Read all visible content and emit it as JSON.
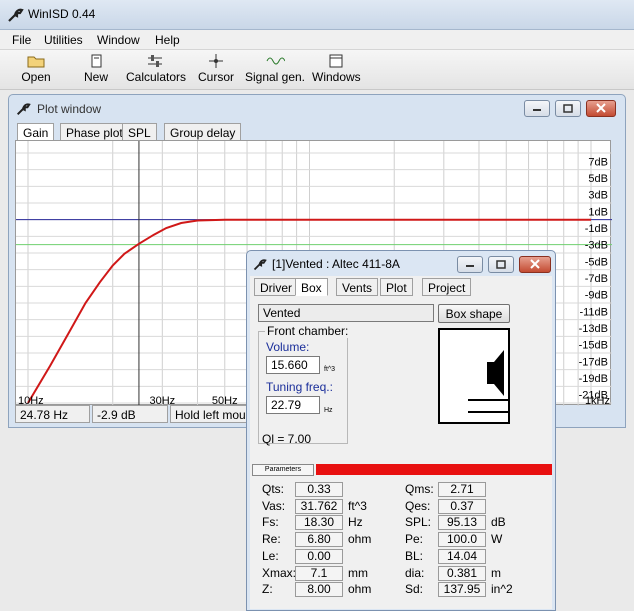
{
  "app": {
    "title": "WinISD 0.44"
  },
  "menu": [
    "File",
    "Utilities",
    "Window",
    "Help"
  ],
  "toolbar": [
    {
      "label": "Open",
      "icon": "folder-icon"
    },
    {
      "label": "New",
      "icon": "new-document-icon"
    },
    {
      "label": "Calculators",
      "icon": "calculator-sliders-icon"
    },
    {
      "label": "Cursor",
      "icon": "crosshair-icon"
    },
    {
      "label": "Signal gen.",
      "icon": "signal-wave-icon"
    },
    {
      "label": "Windows",
      "icon": "window-icon"
    }
  ],
  "plot_window": {
    "title": "Plot window",
    "tabs": [
      "Gain",
      "Phase plot",
      "SPL",
      "Group delay"
    ],
    "active_tab": "Gain",
    "y_labels": [
      "7dB",
      "5dB",
      "3dB",
      "1dB",
      "-1dB",
      "-3dB",
      "-5dB",
      "-7dB",
      "-9dB",
      "-11dB",
      "-13dB",
      "-15dB",
      "-17dB",
      "-19dB",
      "-21dB"
    ],
    "x_labels": [
      "10Hz",
      "30Hz",
      "50Hz",
      "1kHz"
    ],
    "status": {
      "freq": "24.78 Hz",
      "gain": "-2.9 dB",
      "hint": "Hold left mous"
    }
  },
  "chart_data": {
    "type": "line",
    "ylabel": "",
    "xlabel": "",
    "ylim": [
      -22,
      8
    ],
    "log_x": true,
    "cursor": {
      "x_hz": 24.78,
      "y_db": -2.9
    },
    "series": [
      {
        "color": "#d01818",
        "points": [
          [
            10,
            -22
          ],
          [
            12,
            -17.5
          ],
          [
            14,
            -13.5
          ],
          [
            16,
            -10
          ],
          [
            18,
            -7.5
          ],
          [
            20,
            -5.5
          ],
          [
            22,
            -4.1
          ],
          [
            24.78,
            -2.9
          ],
          [
            28,
            -1.8
          ],
          [
            31,
            -1
          ],
          [
            35,
            -0.4
          ],
          [
            40,
            -0.1
          ],
          [
            50,
            0
          ],
          [
            1000,
            0
          ]
        ]
      }
    ]
  },
  "box_window": {
    "title": "[1]Vented : Altec 411-8A",
    "tabs": [
      "Driver",
      "Box",
      "Vents",
      "Plot",
      "Project"
    ],
    "active_tab": "Box",
    "box_type": "Vented",
    "box_shape_button": "Box shape",
    "front_chamber_label": "Front chamber:",
    "volume_label": "Volume:",
    "volume_value": "15.660",
    "volume_unit": "ft^3",
    "tuning_label": "Tuning freq.:",
    "tuning_value": "22.79",
    "tuning_unit": "Hz",
    "ql": "Ql = 7.00",
    "params_header": "Parameters",
    "params_left": [
      {
        "label": "Qts:",
        "value": "0.33",
        "unit": ""
      },
      {
        "label": "Vas:",
        "value": "31.762",
        "unit": "ft^3"
      },
      {
        "label": "Fs:",
        "value": "18.30",
        "unit": "Hz"
      },
      {
        "label": "Re:",
        "value": "6.80",
        "unit": "ohm"
      },
      {
        "label": "Le:",
        "value": "0.00",
        "unit": ""
      },
      {
        "label": "Xmax:",
        "value": "7.1",
        "unit": "mm"
      },
      {
        "label": "Z:",
        "value": "8.00",
        "unit": "ohm"
      }
    ],
    "params_right": [
      {
        "label": "Qms:",
        "value": "2.71",
        "unit": ""
      },
      {
        "label": "Qes:",
        "value": "0.37",
        "unit": ""
      },
      {
        "label": "SPL:",
        "value": "95.13",
        "unit": "dB"
      },
      {
        "label": "Pe:",
        "value": "100.0",
        "unit": "W"
      },
      {
        "label": "BL:",
        "value": "14.04",
        "unit": ""
      },
      {
        "label": "dia:",
        "value": "0.381",
        "unit": "m"
      },
      {
        "label": "Sd:",
        "value": "137.95",
        "unit": "in^2"
      }
    ]
  }
}
